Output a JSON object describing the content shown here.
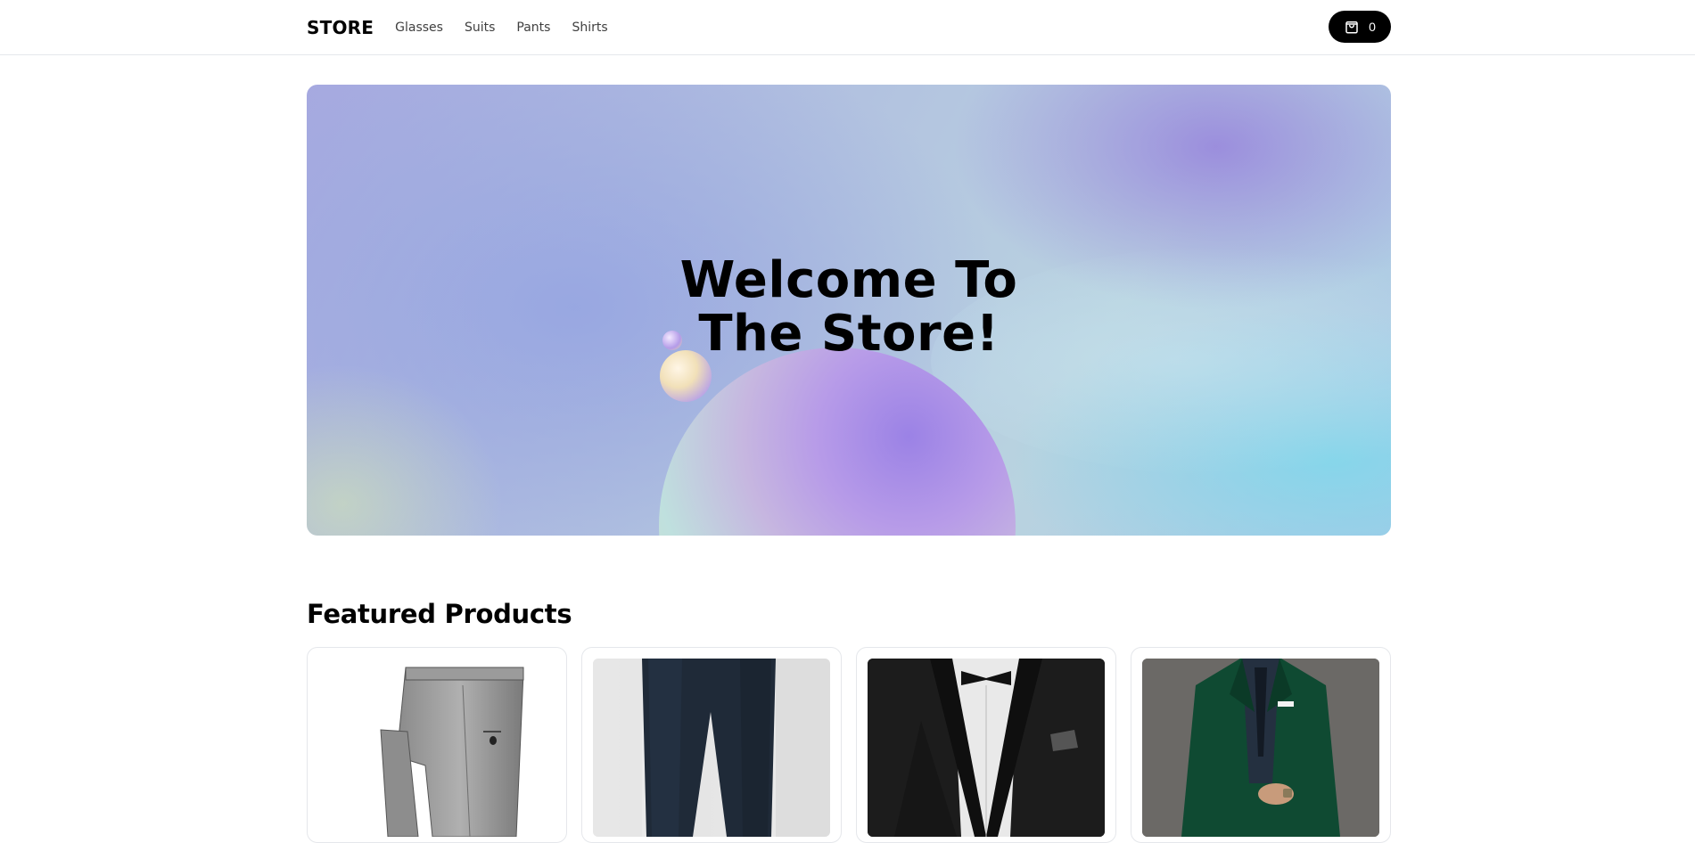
{
  "header": {
    "brand": "STORE",
    "nav": [
      "Glasses",
      "Suits",
      "Pants",
      "Shirts"
    ],
    "cart_count": "0"
  },
  "hero": {
    "title": "Welcome To The Store!"
  },
  "featured": {
    "title": "Featured Products",
    "products": [
      {
        "image": "grey-dress-pants"
      },
      {
        "image": "navy-jeans"
      },
      {
        "image": "black-tuxedo"
      },
      {
        "image": "green-suit"
      }
    ]
  },
  "colors": {
    "cart_button_bg": "#000000",
    "border": "#e5e7eb"
  },
  "icons": {
    "cart": "shopping-bag-icon"
  }
}
